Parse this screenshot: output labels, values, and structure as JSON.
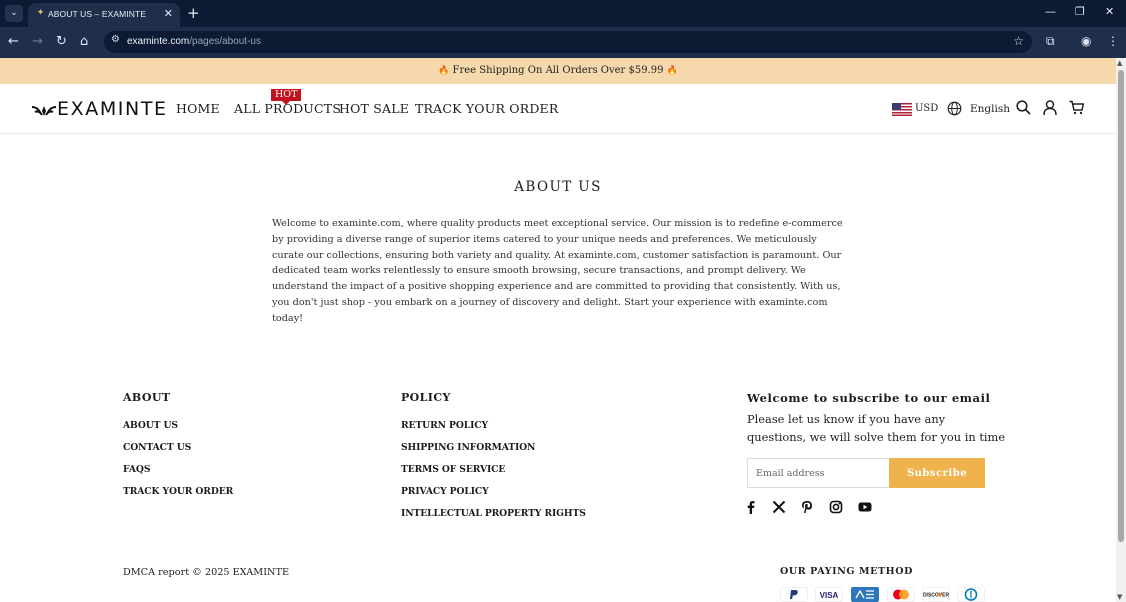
{
  "browser": {
    "tab_title": "ABOUT US – EXAMINTE",
    "tab_close": "✕",
    "new_tab": "+",
    "url_host": "examinte.com",
    "url_path": "/pages/about-us",
    "window_controls": {
      "minimize": "—",
      "restore": "❐",
      "close": "✕"
    }
  },
  "announcement": {
    "text": "Free Shipping On All Orders Over $59.99",
    "icon": "flame-icon"
  },
  "header": {
    "logo_text": "EXAMINTE",
    "nav": [
      {
        "label": "HOME"
      },
      {
        "label": "ALL PRODUCTS",
        "badge": "HOT"
      },
      {
        "label": "HOT SALE"
      },
      {
        "label": "TRACK YOUR ORDER"
      }
    ],
    "currency": "USD",
    "language": "English",
    "icons": [
      "search-icon",
      "account-icon",
      "cart-icon"
    ]
  },
  "main": {
    "title": "ABOUT US",
    "body": "Welcome to examinte.com, where quality products meet exceptional service. Our mission is to redefine e-commerce by providing a diverse range of superior items catered to your unique needs and preferences. We meticulously curate our collections, ensuring both variety and quality. At examinte.com, customer satisfaction is paramount. Our dedicated team works relentlessly to ensure smooth browsing, secure transactions, and prompt delivery. We understand the impact of a positive shopping experience and are committed to providing that consistently. With us, you don't just shop - you embark on a journey of discovery and delight. Start your experience with examinte.com today!"
  },
  "footer": {
    "about": {
      "heading": "ABOUT",
      "links": [
        "ABOUT US",
        "CONTACT US",
        "FAQS",
        "TRACK YOUR ORDER"
      ]
    },
    "policy": {
      "heading": "POLICY",
      "links": [
        "RETURN POLICY",
        "SHIPPING INFORMATION",
        "TERMS OF SERVICE",
        "PRIVACY POLICY",
        "INTELLECTUAL PROPERTY RIGHTS"
      ]
    },
    "subscribe": {
      "heading": "Welcome to subscribe to our email",
      "text": "Please let us know if you have any questions, we will solve them for you in time",
      "placeholder": "Email address",
      "button": "Subscribe"
    },
    "social": [
      "facebook-icon",
      "x-icon",
      "pinterest-icon",
      "instagram-icon",
      "youtube-icon"
    ],
    "copyright": "DMCA report © 2025 EXAMINTE",
    "payment": {
      "heading": "OUR PAYING METHOD",
      "methods": [
        "PayPal",
        "VISA",
        "AMEX",
        "Mastercard",
        "DISCOVER",
        "Diners Club"
      ]
    }
  },
  "colors": {
    "announcement_bg": "#f6d8ad",
    "hot_badge": "#c1121f",
    "subscribe_button": "#f0b24d",
    "browser_dark": "#0c1a33",
    "browser_toolbar": "#1f2e4a"
  }
}
